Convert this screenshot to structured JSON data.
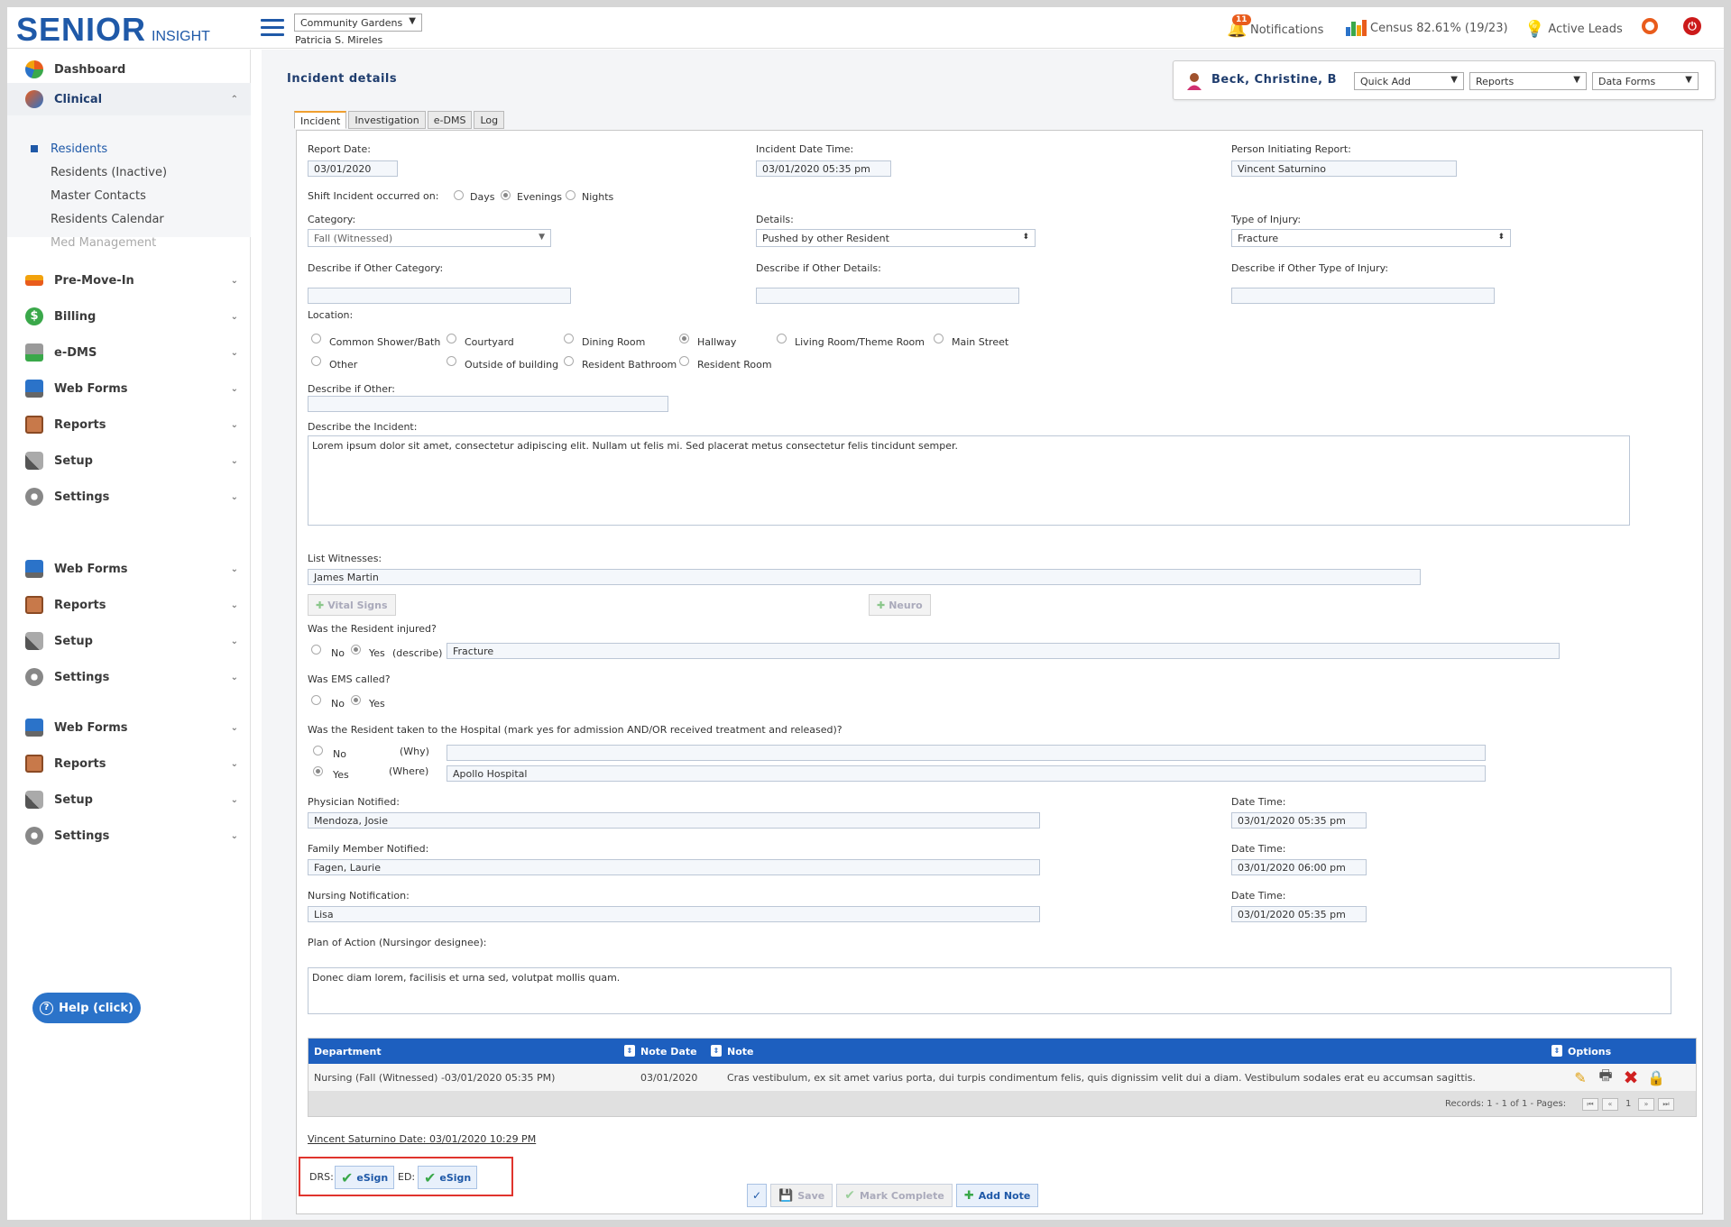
{
  "header": {
    "logo_main": "SENIOR",
    "logo_sub": "INSIGHT",
    "community": "Community Gardens",
    "user": "Patricia S. Mireles",
    "notifications_count": "11",
    "notifications_label": "Notifications",
    "census_label": "Census 82.61% (19/23)",
    "active_leads_label": "Active Leads"
  },
  "sidebar": {
    "items": [
      {
        "label": "Dashboard"
      },
      {
        "label": "Clinical"
      },
      {
        "label": "Pre-Move-In"
      },
      {
        "label": "Billing"
      },
      {
        "label": "e-DMS"
      },
      {
        "label": "Web Forms"
      },
      {
        "label": "Reports"
      },
      {
        "label": "Setup"
      },
      {
        "label": "Settings"
      },
      {
        "label": "Web Forms"
      },
      {
        "label": "Reports"
      },
      {
        "label": "Setup"
      },
      {
        "label": "Settings"
      },
      {
        "label": "Web Forms"
      },
      {
        "label": "Reports"
      },
      {
        "label": "Setup"
      },
      {
        "label": "Settings"
      }
    ],
    "clinical_sub": [
      {
        "label": "Residents"
      },
      {
        "label": "Residents (Inactive)"
      },
      {
        "label": "Master Contacts"
      },
      {
        "label": "Residents Calendar"
      },
      {
        "label": "Med Management"
      }
    ],
    "help_label": "Help (click)"
  },
  "page": {
    "title": "Incident details",
    "resident_name": "Beck, Christine, B",
    "quick_add": "Quick Add",
    "reports": "Reports",
    "data_forms": "Data Forms",
    "tabs": [
      "Incident",
      "Investigation",
      "e-DMS",
      "Log"
    ]
  },
  "form": {
    "report_date_label": "Report Date:",
    "report_date": "03/01/2020",
    "incident_dt_label": "Incident Date Time:",
    "incident_dt": "03/01/2020 05:35 pm",
    "person_label": "Person Initiating Report:",
    "person": "Vincent Saturnino",
    "shift_label": "Shift Incident occurred on:",
    "shift_options": [
      "Days",
      "Evenings",
      "Nights"
    ],
    "category_label": "Category:",
    "category": "Fall (Witnessed)",
    "details_label": "Details:",
    "details": "Pushed by other Resident",
    "injury_type_label": "Type of Injury:",
    "injury_type": "Fracture",
    "other_category_label": "Describe if Other Category:",
    "other_details_label": "Describe if Other Details:",
    "other_injury_label": "Describe if Other Type of Injury:",
    "location_label": "Location:",
    "locations": [
      "Common Shower/Bath",
      "Courtyard",
      "Dining Room",
      "Hallway",
      "Living Room/Theme Room",
      "Main Street",
      "Other",
      "Outside of building",
      "Resident Bathroom",
      "Resident Room"
    ],
    "describe_other_label": "Describe if Other:",
    "describe_incident_label": "Describe the Incident:",
    "incident_text": "Lorem ipsum dolor sit amet, consectetur adipiscing elit. Nullam ut felis mi. Sed placerat metus consectetur felis tincidunt semper.",
    "witnesses_label": "List Witnesses:",
    "witnesses": "James Martin",
    "vital_signs": "Vital Signs",
    "neuro": "Neuro",
    "injured_q": "Was the Resident injured?",
    "no": "No",
    "yes": "Yes",
    "describe": "(describe)",
    "injury_desc": "Fracture",
    "ems_q": "Was EMS called?",
    "hospital_q": "Was the Resident taken to the Hospital (mark yes for admission AND/OR received treatment and released)?",
    "why": "(Why)",
    "where": "(Where)",
    "hospital": "Apollo Hospital",
    "physician_label": "Physician Notified:",
    "physician": "Mendoza, Josie",
    "physician_dt": "03/01/2020 05:35 pm",
    "family_label": "Family Member Notified:",
    "family": "Fagen, Laurie",
    "family_dt": "03/01/2020 06:00 pm",
    "nursing_label": "Nursing Notification:",
    "nursing": "Lisa",
    "nursing_dt": "03/01/2020 05:35 pm",
    "datetime_label": "Date Time:",
    "plan_label": "Plan of Action (Nursingor designee):",
    "plan_text": "Donec diam lorem, facilisis et urna sed, volutpat mollis quam."
  },
  "grid": {
    "headers": {
      "department": "Department",
      "note_date": "Note Date",
      "note": "Note",
      "options": "Options"
    },
    "row": {
      "department": "Nursing (Fall (Witnessed) -03/01/2020 05:35 PM)",
      "note_date": "03/01/2020",
      "note": "Cras vestibulum, ex sit amet varius porta, dui turpis condimentum felis, quis dignissim velit dui a diam. Vestibulum sodales erat eu accumsan sagittis."
    },
    "records": "Records: 1 - 1 of 1 - Pages:",
    "page": "1"
  },
  "signature": {
    "line": "Vincent Saturnino Date: 03/01/2020 10:29 PM",
    "drs": "DRS:",
    "ed": "ED:",
    "esign": "eSign"
  },
  "actions": {
    "save": "Save",
    "mark_complete": "Mark Complete",
    "add_note": "Add Note"
  }
}
